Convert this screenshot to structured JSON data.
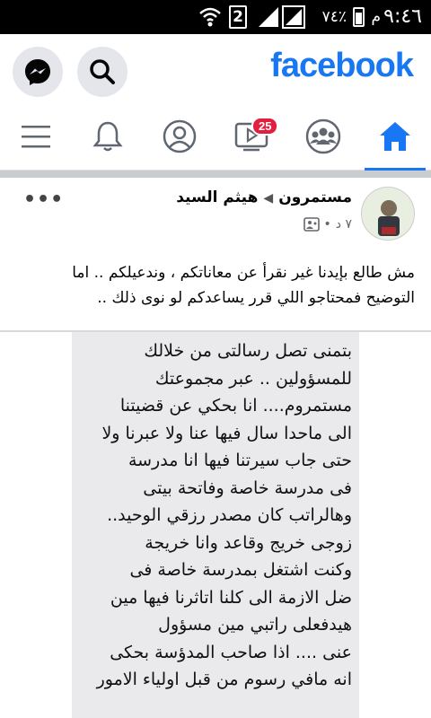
{
  "status_bar": {
    "time": "٩:٤٦",
    "ampm": "م",
    "battery_percent": "٧٤٪",
    "sim_slot": "2"
  },
  "header": {
    "logo": "facebook",
    "search_icon": "search-icon",
    "messenger_icon": "messenger-icon"
  },
  "tabs": [
    {
      "name": "home",
      "icon": "home-icon",
      "active": true
    },
    {
      "name": "groups",
      "icon": "groups-icon"
    },
    {
      "name": "watch",
      "icon": "video-icon",
      "badge": "25"
    },
    {
      "name": "profile",
      "icon": "profile-icon"
    },
    {
      "name": "notifications",
      "icon": "bell-icon"
    },
    {
      "name": "menu",
      "icon": "menu-icon"
    }
  ],
  "post": {
    "author": "هيثم السيد",
    "group": "مستمرون",
    "time": "٧ د",
    "text_lines": [
      "مش طالع بإيدنا غير نقرأ عن معاناتكم ، وندعيلكم .. اما",
      "التوضيح فمحتاجو اللي قرر يساعدكم لو نوى ذلك .."
    ],
    "image_lines": [
      "بتمنى تصل رسالتى من خلالك",
      "للمسؤولين .. عبر مجموعتك",
      "مستمروم.... انا بحكي عن قضيتنا",
      "الى ماحدا سال فيها عنا ولا عبرنا ولا",
      "حتى جاب سيرتنا فيها انا مدرسة",
      "فى مدرسة خاصة وفاتحة بيتى",
      "وهالراتب كان مصدر رزقي الوحيد..",
      "زوجى خريج وقاعد وانا خريجة",
      "وكنت اشتغل بمدرسة خاصة فى",
      "ضل الازمة الى كلنا اتاثرنا فيها مين",
      "هيدفعلى راتبي مين مسؤول",
      "عنى .... اذا صاحب المدؤسة بحكى",
      "انه مافي رسوم من قبل اولياء الامور"
    ]
  },
  "colors": {
    "brand": "#1877f2",
    "badge": "#e41e3f"
  }
}
